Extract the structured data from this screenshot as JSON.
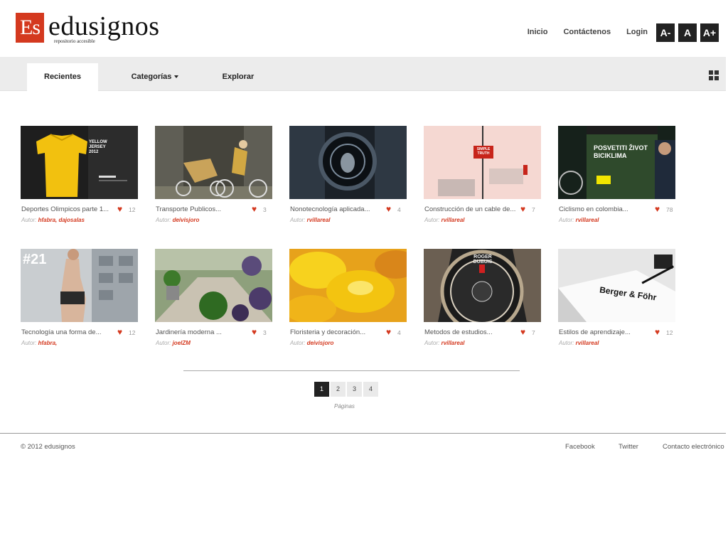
{
  "header": {
    "logo_mark": "Es",
    "logo_name": "edusignos",
    "logo_tagline": "repositorio accesible",
    "nav": [
      "Inicio",
      "Contáctenos",
      "Login"
    ],
    "font_buttons": [
      "A-",
      "A",
      "A+"
    ]
  },
  "tabs": {
    "recent": "Recientes",
    "categories": "Categorías",
    "explore": "Explorar"
  },
  "author_prefix": "Autor:",
  "cards": [
    {
      "title": "Deportes Olimpicos parte 1...",
      "likes": "12",
      "authors": "hfabra, dajosalas",
      "thumb_text": "YELLOW JERSEY 2012"
    },
    {
      "title": "Transporte Publicos...",
      "likes": "3",
      "authors": "deivisjoro",
      "thumb_text": ""
    },
    {
      "title": "Nonotecnología aplicada...",
      "likes": "4",
      "authors": "rvillareal",
      "thumb_text": ""
    },
    {
      "title": "Construcción de un cable de...",
      "likes": "7",
      "authors": "rvillareal",
      "thumb_text": "SIMPLE TRUTH"
    },
    {
      "title": "Ciclismo en colombia...",
      "likes": "78",
      "authors": "rvillareal",
      "thumb_text": "POSVETITI ŽIVOT BICIKLIMA"
    },
    {
      "title": "Tecnología una forma de...",
      "likes": "12",
      "authors": "hfabra,",
      "thumb_text": "#21"
    },
    {
      "title": "Jardinería moderna ...",
      "likes": "3",
      "authors": "joelZM",
      "thumb_text": ""
    },
    {
      "title": "Floristeria y decoración...",
      "likes": "4",
      "authors": "deivisjoro",
      "thumb_text": ""
    },
    {
      "title": "Metodos de estudios...",
      "likes": "7",
      "authors": "rvillareal",
      "thumb_text": "ROGER DUBUIS"
    },
    {
      "title": "Estilos de aprendizaje...",
      "likes": "12",
      "authors": "rvillareal",
      "thumb_text": "Berger & Föhr"
    }
  ],
  "pagination": {
    "pages": [
      "1",
      "2",
      "3",
      "4"
    ],
    "current": "1",
    "label": "Páginas"
  },
  "footer": {
    "copyright": "© 2012  edusignos",
    "links": [
      "Facebook",
      "Twitter",
      "Contacto electrónico"
    ]
  },
  "colors": {
    "accent": "#d4391f",
    "dark": "#222222",
    "navbar": "#ececec"
  }
}
